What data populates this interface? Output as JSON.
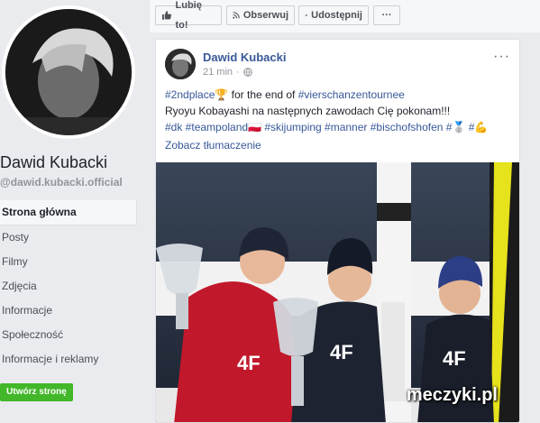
{
  "sidebar": {
    "page_name": "Dawid Kubacki",
    "page_handle": "@dawid.kubacki.official",
    "nav": [
      {
        "label": "Strona główna",
        "active": true
      },
      {
        "label": "Posty"
      },
      {
        "label": "Filmy"
      },
      {
        "label": "Zdjęcia"
      },
      {
        "label": "Informacje"
      },
      {
        "label": "Społeczność"
      },
      {
        "label": "Informacje i reklamy"
      }
    ],
    "create_page_label": "Utwórz stronę"
  },
  "actionbar": {
    "like_label": "Lubię to!",
    "follow_label": "Obserwuj",
    "share_label": "Udostępnij",
    "more_label": "···"
  },
  "post": {
    "author": "Dawid Kubacki",
    "time": "21 min",
    "more_label": "···",
    "line1_tag1": "#2ndplace",
    "line1_emoji": "🏆",
    "line1_mid": " for the end of ",
    "line1_tag2": "#vierschanzentournee",
    "line2": "Ryoyu Kobayashi na następnych zawodach Cię pokonam!!!",
    "line3_tags": "#dk #teampoland🇵🇱 #skijumping #manner #bischofshofen #🥈 #💪",
    "translate_label": "Zobacz tłumaczenie",
    "watermark": "meczyki.pl"
  },
  "colors": {
    "link": "#385898",
    "create_button": "#42b72a",
    "background": "#e9ebee"
  }
}
